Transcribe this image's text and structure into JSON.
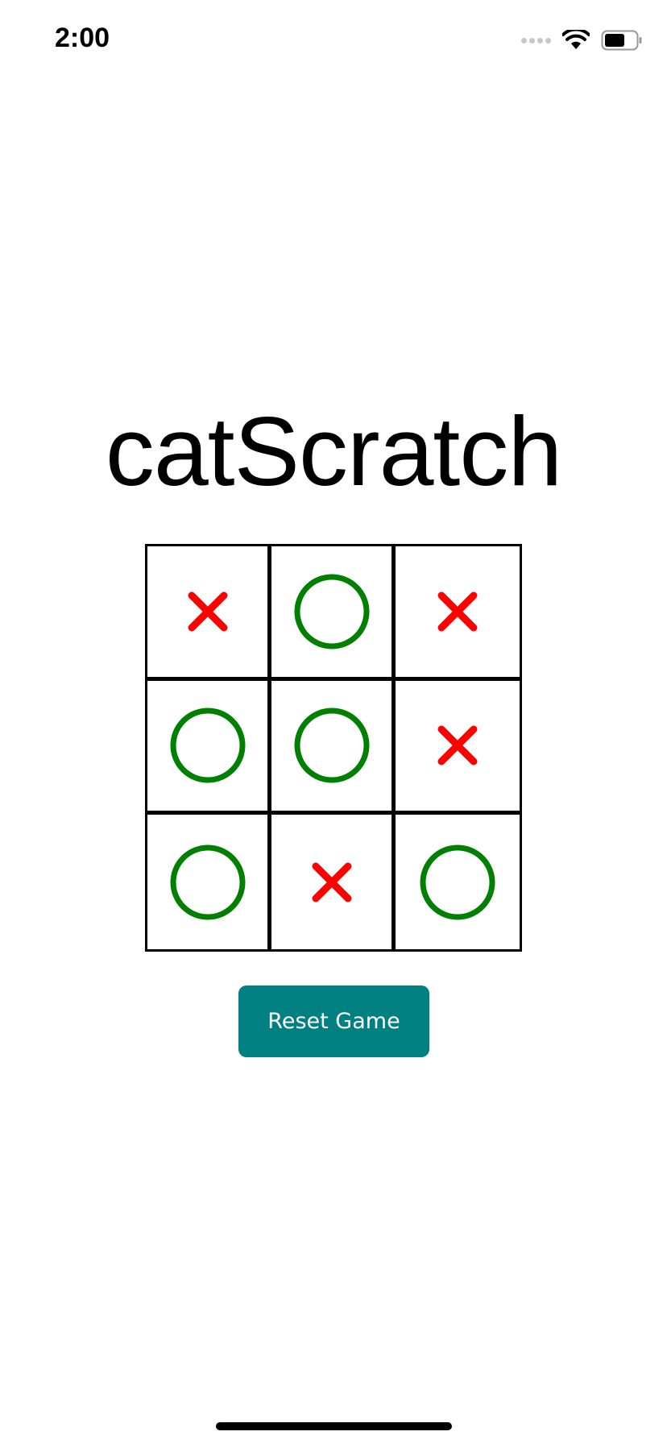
{
  "status_bar": {
    "time": "2:00",
    "icons": [
      "signal-icon",
      "wifi-icon",
      "battery-icon"
    ]
  },
  "app": {
    "title": "catScratch"
  },
  "board": {
    "cells": [
      [
        "X",
        "O",
        "X"
      ],
      [
        "O",
        "O",
        "X"
      ],
      [
        "O",
        "X",
        "O"
      ]
    ]
  },
  "controls": {
    "reset_label": "Reset Game"
  },
  "colors": {
    "x_mark": "#ff0000",
    "o_mark": "#008000",
    "button_bg": "#008080",
    "grid": "#000000"
  }
}
